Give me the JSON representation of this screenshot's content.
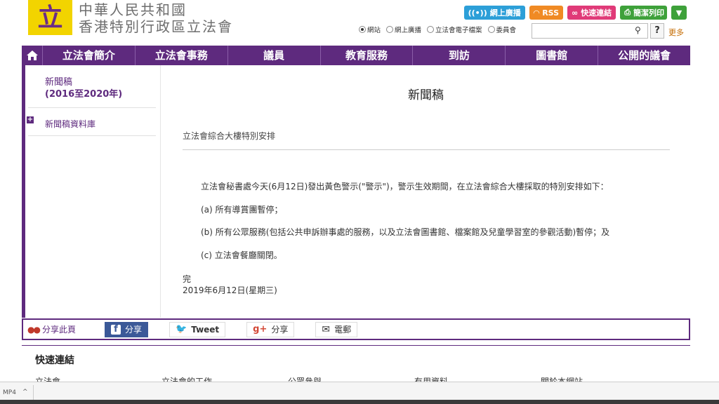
{
  "header": {
    "logo_char": "立",
    "title_line1": "中華人民共和國",
    "title_line2": "香港特別行政區立法會"
  },
  "top_buttons": {
    "webcast": "網上廣播",
    "rss": "RSS",
    "quick_links": "快速連結",
    "print": "簡潔列印"
  },
  "search": {
    "options": [
      "網站",
      "網上廣播",
      "立法會電子檔案",
      "委員會"
    ],
    "selected": "網站",
    "value": "",
    "help": "?",
    "more": "更多"
  },
  "nav": {
    "items": [
      "立法會簡介",
      "立法會事務",
      "議員",
      "教育服務",
      "到訪",
      "圖書館",
      "公開的議會"
    ]
  },
  "sidebar": {
    "title_line1": "新聞稿",
    "title_line2": "(2016至2020年)",
    "item": "新聞稿資料庫"
  },
  "content": {
    "page_title": "新聞稿",
    "subtitle": "立法會綜合大樓特別安排",
    "paragraphs": [
      "立法會秘書處今天(6月12日)發出黃色警示(\"警示\")，警示生效期間，在立法會綜合大樓採取的特別安排如下：",
      "(a) 所有導賞團暫停；",
      "(b) 所有公眾服務(包括公共申訴辦事處的服務，以及立法會圖書館、檔案館及兒童學習室的參觀活動)暫停；及",
      "(c) 立法會餐廳關閉。"
    ],
    "end": "完",
    "date": "2019年6月12日(星期三)"
  },
  "share": {
    "label": "分享此頁",
    "facebook": "分享",
    "twitter": "Tweet",
    "gplus": "分享",
    "email": "電郵"
  },
  "footer": {
    "quick_title": "快速連結",
    "columns": [
      "立法會",
      "立法會的工作",
      "公眾參與",
      "有用資料",
      "關於本網站"
    ]
  },
  "downloads": {
    "item": "MP4",
    "caret": "^"
  }
}
